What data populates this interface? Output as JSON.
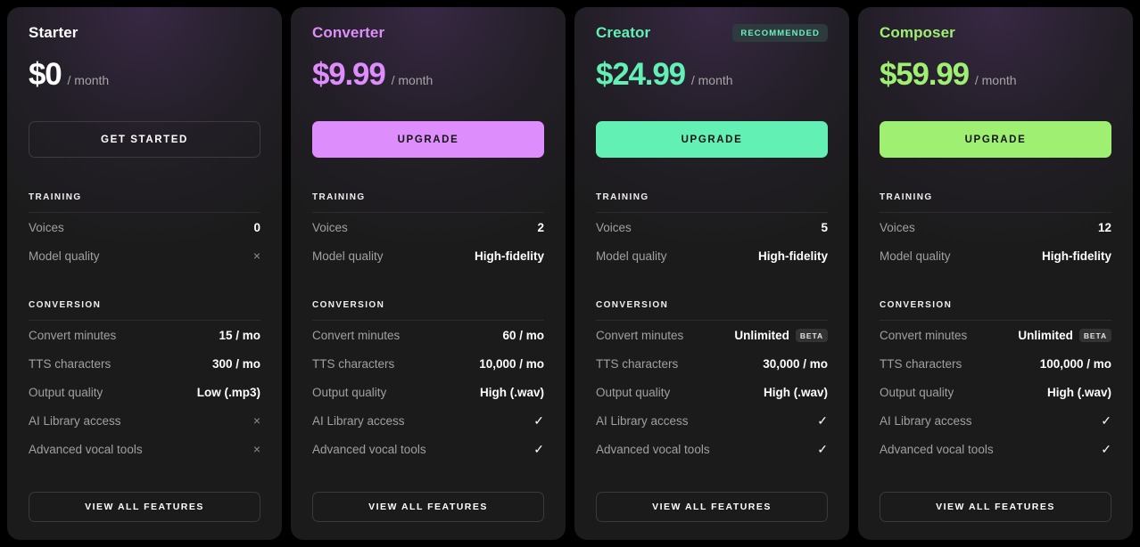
{
  "common": {
    "price_period": "/ month",
    "training_section": "TRAINING",
    "conversion_section": "CONVERSION",
    "view_all_label": "VIEW ALL FEATURES",
    "beta_label": "BETA",
    "check_glyph": "✓",
    "cross_glyph": "×",
    "labels": {
      "voices": "Voices",
      "model_quality": "Model quality",
      "convert_minutes": "Convert minutes",
      "tts_characters": "TTS characters",
      "output_quality": "Output quality",
      "ai_library": "AI Library access",
      "vocal_tools": "Advanced vocal tools"
    }
  },
  "plans": [
    {
      "name": "Starter",
      "accent": "#ffffff",
      "name_color": "#ffffff",
      "price": "$0",
      "cta_label": "GET STARTED",
      "cta_style": "outline",
      "badge": null,
      "training": [
        {
          "label": "Voices",
          "value": "0",
          "type": "text"
        },
        {
          "label": "Model quality",
          "value": "×",
          "type": "cross"
        }
      ],
      "conversion": [
        {
          "label": "Convert minutes",
          "value": "15 / mo",
          "type": "text"
        },
        {
          "label": "TTS characters",
          "value": "300 / mo",
          "type": "text"
        },
        {
          "label": "Output quality",
          "value": "Low (.mp3)",
          "type": "text"
        },
        {
          "label": "AI Library access",
          "value": "×",
          "type": "cross"
        },
        {
          "label": "Advanced vocal tools",
          "value": "×",
          "type": "cross"
        }
      ]
    },
    {
      "name": "Converter",
      "accent": "#dd8efc",
      "name_color": "#dd8efc",
      "price": "$9.99",
      "cta_label": "UPGRADE",
      "cta_style": "filled",
      "badge": null,
      "training": [
        {
          "label": "Voices",
          "value": "2",
          "type": "text"
        },
        {
          "label": "Model quality",
          "value": "High-fidelity",
          "type": "text"
        }
      ],
      "conversion": [
        {
          "label": "Convert minutes",
          "value": "60 / mo",
          "type": "text"
        },
        {
          "label": "TTS characters",
          "value": "10,000 / mo",
          "type": "text"
        },
        {
          "label": "Output quality",
          "value": "High (.wav)",
          "type": "text"
        },
        {
          "label": "AI Library access",
          "value": "✓",
          "type": "check"
        },
        {
          "label": "Advanced vocal tools",
          "value": "✓",
          "type": "check"
        }
      ]
    },
    {
      "name": "Creator",
      "accent": "#62f0b5",
      "name_color": "#62f0b5",
      "price": "$24.99",
      "cta_label": "UPGRADE",
      "cta_style": "filled",
      "badge": "RECOMMENDED",
      "training": [
        {
          "label": "Voices",
          "value": "5",
          "type": "text"
        },
        {
          "label": "Model quality",
          "value": "High-fidelity",
          "type": "text"
        }
      ],
      "conversion": [
        {
          "label": "Convert minutes",
          "value": "Unlimited",
          "type": "text",
          "badge": "BETA"
        },
        {
          "label": "TTS characters",
          "value": "30,000 / mo",
          "type": "text"
        },
        {
          "label": "Output quality",
          "value": "High (.wav)",
          "type": "text"
        },
        {
          "label": "AI Library access",
          "value": "✓",
          "type": "check"
        },
        {
          "label": "Advanced vocal tools",
          "value": "✓",
          "type": "check"
        }
      ]
    },
    {
      "name": "Composer",
      "accent": "#9ff072",
      "name_color": "#9ff072",
      "price": "$59.99",
      "cta_label": "UPGRADE",
      "cta_style": "filled",
      "badge": null,
      "training": [
        {
          "label": "Voices",
          "value": "12",
          "type": "text"
        },
        {
          "label": "Model quality",
          "value": "High-fidelity",
          "type": "text"
        }
      ],
      "conversion": [
        {
          "label": "Convert minutes",
          "value": "Unlimited",
          "type": "text",
          "badge": "BETA"
        },
        {
          "label": "TTS characters",
          "value": "100,000 / mo",
          "type": "text"
        },
        {
          "label": "Output quality",
          "value": "High (.wav)",
          "type": "text"
        },
        {
          "label": "AI Library access",
          "value": "✓",
          "type": "check"
        },
        {
          "label": "Advanced vocal tools",
          "value": "✓",
          "type": "check"
        }
      ]
    }
  ]
}
